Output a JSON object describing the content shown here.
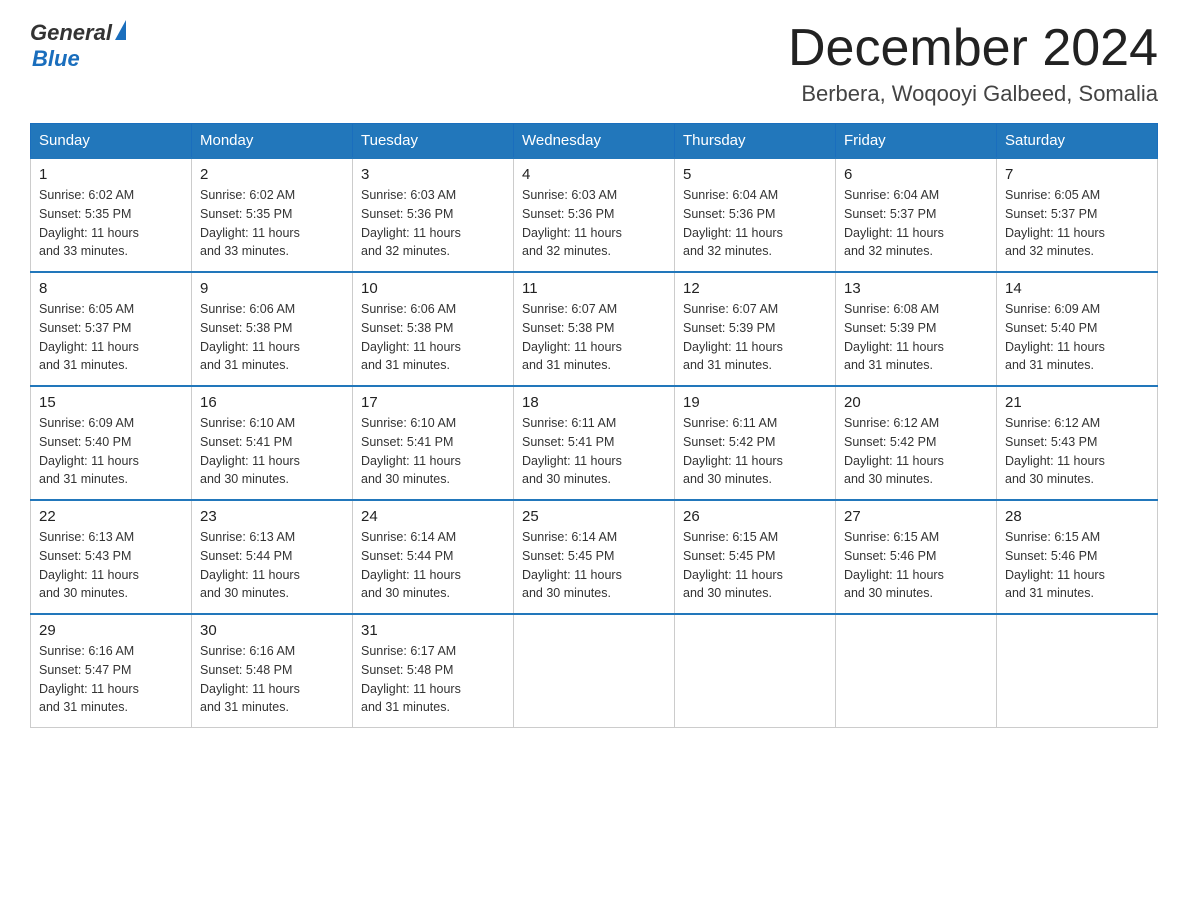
{
  "header": {
    "logo_general": "General",
    "logo_blue": "Blue",
    "month_title": "December 2024",
    "location": "Berbera, Woqooyi Galbeed, Somalia"
  },
  "days_of_week": [
    "Sunday",
    "Monday",
    "Tuesday",
    "Wednesday",
    "Thursday",
    "Friday",
    "Saturday"
  ],
  "weeks": [
    [
      {
        "day": "1",
        "sunrise": "6:02 AM",
        "sunset": "5:35 PM",
        "daylight": "11 hours and 33 minutes."
      },
      {
        "day": "2",
        "sunrise": "6:02 AM",
        "sunset": "5:35 PM",
        "daylight": "11 hours and 33 minutes."
      },
      {
        "day": "3",
        "sunrise": "6:03 AM",
        "sunset": "5:36 PM",
        "daylight": "11 hours and 32 minutes."
      },
      {
        "day": "4",
        "sunrise": "6:03 AM",
        "sunset": "5:36 PM",
        "daylight": "11 hours and 32 minutes."
      },
      {
        "day": "5",
        "sunrise": "6:04 AM",
        "sunset": "5:36 PM",
        "daylight": "11 hours and 32 minutes."
      },
      {
        "day": "6",
        "sunrise": "6:04 AM",
        "sunset": "5:37 PM",
        "daylight": "11 hours and 32 minutes."
      },
      {
        "day": "7",
        "sunrise": "6:05 AM",
        "sunset": "5:37 PM",
        "daylight": "11 hours and 32 minutes."
      }
    ],
    [
      {
        "day": "8",
        "sunrise": "6:05 AM",
        "sunset": "5:37 PM",
        "daylight": "11 hours and 31 minutes."
      },
      {
        "day": "9",
        "sunrise": "6:06 AM",
        "sunset": "5:38 PM",
        "daylight": "11 hours and 31 minutes."
      },
      {
        "day": "10",
        "sunrise": "6:06 AM",
        "sunset": "5:38 PM",
        "daylight": "11 hours and 31 minutes."
      },
      {
        "day": "11",
        "sunrise": "6:07 AM",
        "sunset": "5:38 PM",
        "daylight": "11 hours and 31 minutes."
      },
      {
        "day": "12",
        "sunrise": "6:07 AM",
        "sunset": "5:39 PM",
        "daylight": "11 hours and 31 minutes."
      },
      {
        "day": "13",
        "sunrise": "6:08 AM",
        "sunset": "5:39 PM",
        "daylight": "11 hours and 31 minutes."
      },
      {
        "day": "14",
        "sunrise": "6:09 AM",
        "sunset": "5:40 PM",
        "daylight": "11 hours and 31 minutes."
      }
    ],
    [
      {
        "day": "15",
        "sunrise": "6:09 AM",
        "sunset": "5:40 PM",
        "daylight": "11 hours and 31 minutes."
      },
      {
        "day": "16",
        "sunrise": "6:10 AM",
        "sunset": "5:41 PM",
        "daylight": "11 hours and 30 minutes."
      },
      {
        "day": "17",
        "sunrise": "6:10 AM",
        "sunset": "5:41 PM",
        "daylight": "11 hours and 30 minutes."
      },
      {
        "day": "18",
        "sunrise": "6:11 AM",
        "sunset": "5:41 PM",
        "daylight": "11 hours and 30 minutes."
      },
      {
        "day": "19",
        "sunrise": "6:11 AM",
        "sunset": "5:42 PM",
        "daylight": "11 hours and 30 minutes."
      },
      {
        "day": "20",
        "sunrise": "6:12 AM",
        "sunset": "5:42 PM",
        "daylight": "11 hours and 30 minutes."
      },
      {
        "day": "21",
        "sunrise": "6:12 AM",
        "sunset": "5:43 PM",
        "daylight": "11 hours and 30 minutes."
      }
    ],
    [
      {
        "day": "22",
        "sunrise": "6:13 AM",
        "sunset": "5:43 PM",
        "daylight": "11 hours and 30 minutes."
      },
      {
        "day": "23",
        "sunrise": "6:13 AM",
        "sunset": "5:44 PM",
        "daylight": "11 hours and 30 minutes."
      },
      {
        "day": "24",
        "sunrise": "6:14 AM",
        "sunset": "5:44 PM",
        "daylight": "11 hours and 30 minutes."
      },
      {
        "day": "25",
        "sunrise": "6:14 AM",
        "sunset": "5:45 PM",
        "daylight": "11 hours and 30 minutes."
      },
      {
        "day": "26",
        "sunrise": "6:15 AM",
        "sunset": "5:45 PM",
        "daylight": "11 hours and 30 minutes."
      },
      {
        "day": "27",
        "sunrise": "6:15 AM",
        "sunset": "5:46 PM",
        "daylight": "11 hours and 30 minutes."
      },
      {
        "day": "28",
        "sunrise": "6:15 AM",
        "sunset": "5:46 PM",
        "daylight": "11 hours and 31 minutes."
      }
    ],
    [
      {
        "day": "29",
        "sunrise": "6:16 AM",
        "sunset": "5:47 PM",
        "daylight": "11 hours and 31 minutes."
      },
      {
        "day": "30",
        "sunrise": "6:16 AM",
        "sunset": "5:48 PM",
        "daylight": "11 hours and 31 minutes."
      },
      {
        "day": "31",
        "sunrise": "6:17 AM",
        "sunset": "5:48 PM",
        "daylight": "11 hours and 31 minutes."
      },
      null,
      null,
      null,
      null
    ]
  ],
  "labels": {
    "sunrise": "Sunrise:",
    "sunset": "Sunset:",
    "daylight": "Daylight:"
  }
}
